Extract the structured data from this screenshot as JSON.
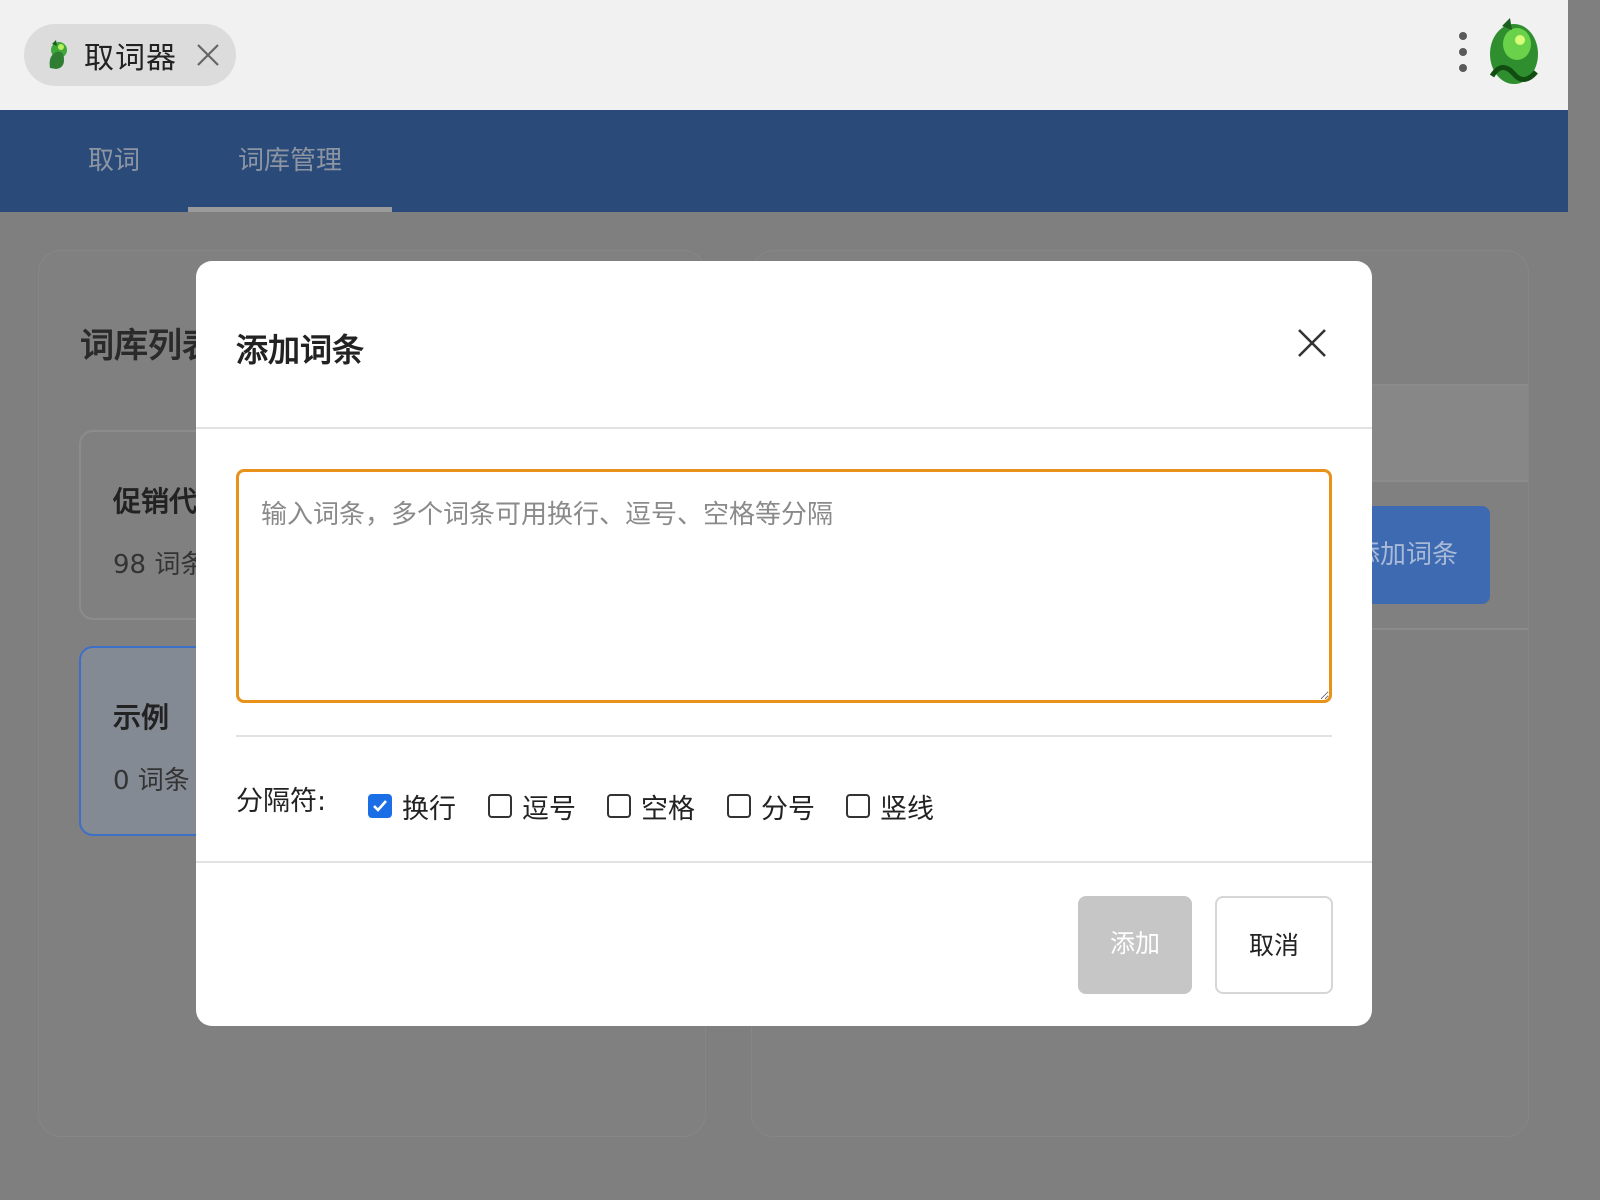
{
  "window": {
    "tab_title": "取词器",
    "app_icon": "app-dragon-icon",
    "menu_icon": "kebab-menu-icon",
    "avatar_icon": "dragon-avatar-icon"
  },
  "nav": {
    "tabs": [
      {
        "label": "取词",
        "active": false
      },
      {
        "label": "词库管理",
        "active": true
      }
    ]
  },
  "background": {
    "library_title": "词库列表",
    "libraries": [
      {
        "name": "促销代",
        "count": "98 词条"
      },
      {
        "name": "示例",
        "count": "0 词条 |"
      }
    ],
    "add_entry_button": "添加词条"
  },
  "dialog": {
    "title": "添加词条",
    "textarea_placeholder": "输入词条，多个词条可用换行、逗号、空格等分隔",
    "textarea_value": "",
    "separator_label": "分隔符:",
    "separators": [
      {
        "label": "换行",
        "checked": true
      },
      {
        "label": "逗号",
        "checked": false
      },
      {
        "label": "空格",
        "checked": false
      },
      {
        "label": "分号",
        "checked": false
      },
      {
        "label": "竖线",
        "checked": false
      }
    ],
    "add_button": "添加",
    "cancel_button": "取消"
  },
  "colors": {
    "nav_bg": "#2a4b79",
    "overlay": "#7f7f7f",
    "focus_border": "#e8921c",
    "checkbox_checked": "#1a6fe6",
    "disabled_button": "#c6c6c6"
  }
}
